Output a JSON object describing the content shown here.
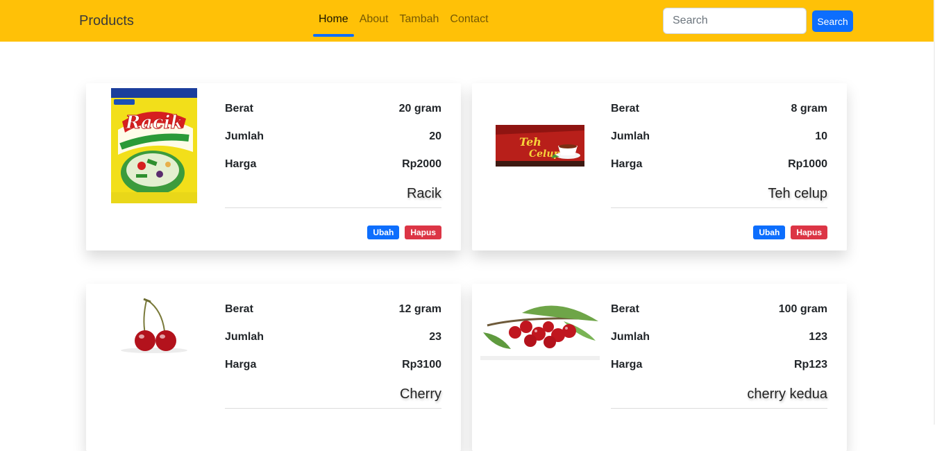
{
  "navbar": {
    "brand": "Products",
    "links": [
      {
        "label": "Home",
        "active": true
      },
      {
        "label": "About",
        "active": false
      },
      {
        "label": "Tambah",
        "active": false
      },
      {
        "label": "Contact",
        "active": false
      }
    ],
    "search_placeholder": "Search",
    "search_button": "Search"
  },
  "labels": {
    "weight": "Berat",
    "quantity": "Jumlah",
    "price": "Harga",
    "edit": "Ubah",
    "delete": "Hapus"
  },
  "products": [
    {
      "name": "Racik",
      "weight": "20 gram",
      "quantity": "20",
      "price": "Rp2000",
      "image": "racik-package"
    },
    {
      "name": "Teh celup",
      "weight": "8 gram",
      "quantity": "10",
      "price": "Rp1000",
      "image": "tea-box"
    },
    {
      "name": "Cherry",
      "weight": "12 gram",
      "quantity": "23",
      "price": "Rp3100",
      "image": "cherry-pair"
    },
    {
      "name": "cherry kedua",
      "weight": "100 gram",
      "quantity": "123",
      "price": "Rp123",
      "image": "cherry-branch"
    }
  ],
  "colors": {
    "navbar": "#ffc107",
    "primary": "#0d6efd",
    "danger": "#dc3545"
  }
}
